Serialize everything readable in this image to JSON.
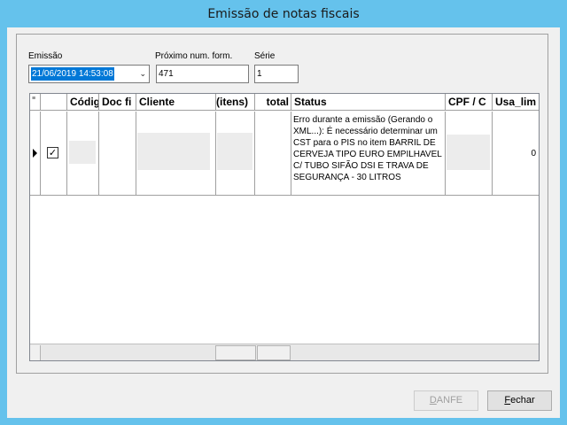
{
  "window": {
    "title": "Emissão de notas fiscais"
  },
  "form": {
    "emissao_label": "Emissão",
    "emissao_value": "21/06/2019 14:53:08",
    "proximo_label": "Próximo num. form.",
    "proximo_value": "471",
    "serie_label": "Série",
    "serie_value": "1"
  },
  "grid": {
    "columns": [
      "Códig",
      "Doc fi",
      "Cliente",
      "(itens)",
      "total",
      "Status",
      "CPF / C",
      "Usa_lim"
    ],
    "rows": [
      {
        "selected": true,
        "checked": true,
        "status": "Erro durante a emissão (Gerando o XML...): É necessário determinar um CST para o PIS no item BARRIL DE CERVEJA TIPO EURO EMPILHAVEL C/ TUBO SIFÃO DSI E TRAVA DE SEGURANÇA - 30 LITROS",
        "usa_lim": "0"
      }
    ]
  },
  "buttons": {
    "danfe_pre": "",
    "danfe_key": "D",
    "danfe_post": "ANFE",
    "fechar_key": "F",
    "fechar_post": "echar"
  },
  "icons": {
    "row_indicator": "row-selector-arrow-icon",
    "checkbox": "checkbox-checked-icon",
    "dropdown": "chevron-down-icon",
    "column_chooser": "column-chooser-icon"
  },
  "colors": {
    "title_bar": "#65c2ec",
    "selection": "#0078d7",
    "client_bg": "#f0f0f0"
  }
}
